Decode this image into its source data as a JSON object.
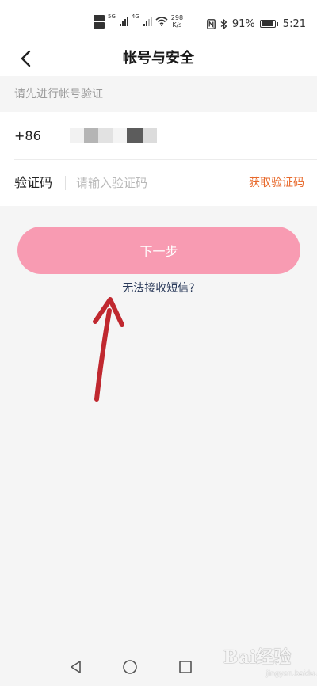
{
  "status_bar": {
    "signal_type_1": "5G",
    "signal_type_2": "4G",
    "net_speed_value": "298",
    "net_speed_unit": "K/s",
    "battery_percent": "91%",
    "battery_level": 0.91,
    "time": "5:21"
  },
  "header": {
    "title": "帐号与安全"
  },
  "verification": {
    "hint": "请先进行帐号验证",
    "country_code": "+86",
    "code_label": "验证码",
    "code_placeholder": "请输入验证码",
    "code_value": "",
    "get_code_label": "获取验证码"
  },
  "actions": {
    "next_label": "下一步",
    "sms_help_label": "无法接收短信?"
  },
  "watermark": {
    "logo_text": "Bai经验",
    "sub_text": "jingyan.baidu.com"
  },
  "colors": {
    "accent_orange": "#e86a2c",
    "button_pink": "#f89bb2",
    "link_navy": "#2a3a5a",
    "annotation_red": "#c0282f"
  },
  "icons": {
    "back": "chevron-left-icon",
    "nfc": "nfc-icon",
    "bluetooth": "bluetooth-icon",
    "wifi": "wifi-icon",
    "battery": "battery-icon",
    "nav_back": "triangle-back-icon",
    "nav_home": "circle-home-icon",
    "nav_recent": "square-recent-icon"
  }
}
